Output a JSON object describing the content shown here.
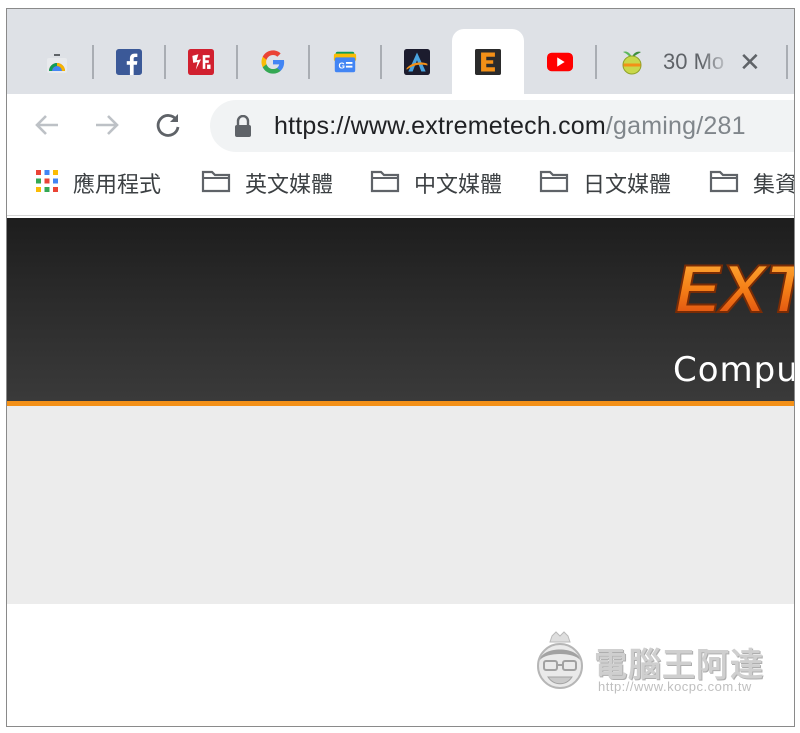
{
  "tabs": [
    {
      "icon": "chrome-webstore-icon",
      "title": ""
    },
    {
      "icon": "facebook-icon",
      "title": ""
    },
    {
      "icon": "red-site-icon",
      "title": ""
    },
    {
      "icon": "google-icon",
      "title": ""
    },
    {
      "icon": "google-news-icon",
      "title": ""
    },
    {
      "icon": "a-logo-icon",
      "title": ""
    },
    {
      "icon": "extremetech-icon",
      "title": "",
      "active": true
    },
    {
      "icon": "youtube-icon",
      "title": ""
    },
    {
      "icon": "fruit-icon",
      "title": "30 Mo"
    }
  ],
  "toolbar": {
    "back": "back-arrow-icon",
    "forward": "forward-arrow-icon",
    "reload": "reload-icon",
    "url_main": "https://www.extremetech.com",
    "url_rest": "/gaming/281"
  },
  "bookmarks": [
    {
      "label": "應用程式",
      "icon": "apps-grid-icon"
    },
    {
      "label": "英文媒體",
      "icon": "folder-icon"
    },
    {
      "label": "中文媒體",
      "icon": "folder-icon"
    },
    {
      "label": "日文媒體",
      "icon": "folder-icon"
    },
    {
      "label": "集資",
      "icon": "folder-icon"
    }
  ],
  "site": {
    "logo_text": "EXT",
    "tagline": "Compu",
    "accent": "#f39017"
  },
  "watermark": {
    "title": "電腦王阿達",
    "url": "http://www.kocpc.com.tw"
  }
}
